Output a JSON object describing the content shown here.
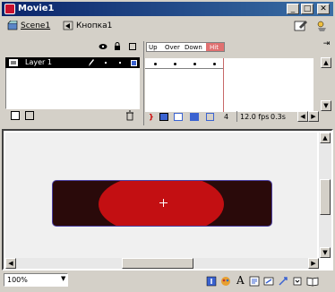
{
  "window": {
    "title": "Movie1"
  },
  "scenebar": {
    "scene": "Scene1",
    "symbol": "Кнопка1"
  },
  "timeline": {
    "frame_labels": [
      "Up",
      "Over",
      "Down",
      "Hit"
    ],
    "layer_name": "Layer 1",
    "current_frame": "4",
    "fps": "12.0 fps",
    "elapsed": "0.3s"
  },
  "statusbar": {
    "zoom": "100%"
  }
}
